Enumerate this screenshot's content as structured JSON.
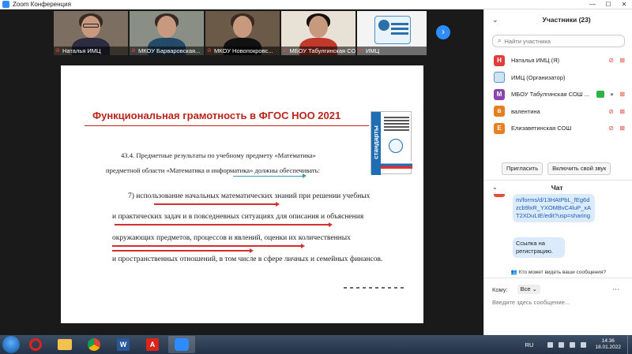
{
  "window": {
    "title": "Zoom Конференция"
  },
  "videos": [
    {
      "name": "Наталья ИМЦ"
    },
    {
      "name": "МКОУ Барваровская..."
    },
    {
      "name": "МКОУ Новопокровс..."
    },
    {
      "name": "МБОУ Табулгинская СО..."
    },
    {
      "name": "ИМЦ"
    }
  ],
  "slide": {
    "title": "Функциональная грамотность в ФГОС НОО 2021",
    "book_spine": "стандарты",
    "para1_line1": "43.4.   Предметные   результаты   по   учебному   предмету   «Математика»",
    "para1_line2": "предметной области «Математика и информатика» должны обеспечивать:",
    "para2_line1": "7) использование начальных математических знаний при решении учебных",
    "para2_line2": "и практических задач и в повседневных ситуациях для описания и объяснения",
    "para2_line3": "окружающих предметов, процессов и явлений, оценки их количественных",
    "para2_line4": "и пространственных отношений, в том числе в сфере личных и семейных финансов."
  },
  "participants_panel": {
    "title": "Участники (23)",
    "search_placeholder": "Найти участника",
    "items": [
      {
        "initial": "Н",
        "name": "Наталья ИМЦ (Я)",
        "color": "#e03d3d"
      },
      {
        "initial": "",
        "name": "ИМЦ (Организатор)",
        "color": "#cfe3f2"
      },
      {
        "initial": "М",
        "name": "МБОУ Табулгинская СОШ ...",
        "color": "#8e44ad"
      },
      {
        "initial": "в",
        "name": "валентина",
        "color": "#e67e22"
      },
      {
        "initial": "Е",
        "name": "Елизаветинская СОШ",
        "color": "#e67e22"
      }
    ],
    "invite_label": "Пригласить",
    "unmute_label": "Включить свой звук"
  },
  "chat": {
    "title": "Чат",
    "messages": [
      "m/forms/d/13HAtPbL_fEg6dzcb9lxR_YXOMBvC4luP_xAT2XDuLtE/edit?usp=sharing",
      "Ссылка на регистрацию."
    ],
    "who_can_see": "Кто может видеть ваши сообщения?",
    "to_label": "Кому:",
    "to_value": "Все",
    "input_placeholder": "Введите здесь сообщение..."
  },
  "taskbar": {
    "lang": "RU",
    "time": "14:36",
    "date": "18.01.2022"
  }
}
